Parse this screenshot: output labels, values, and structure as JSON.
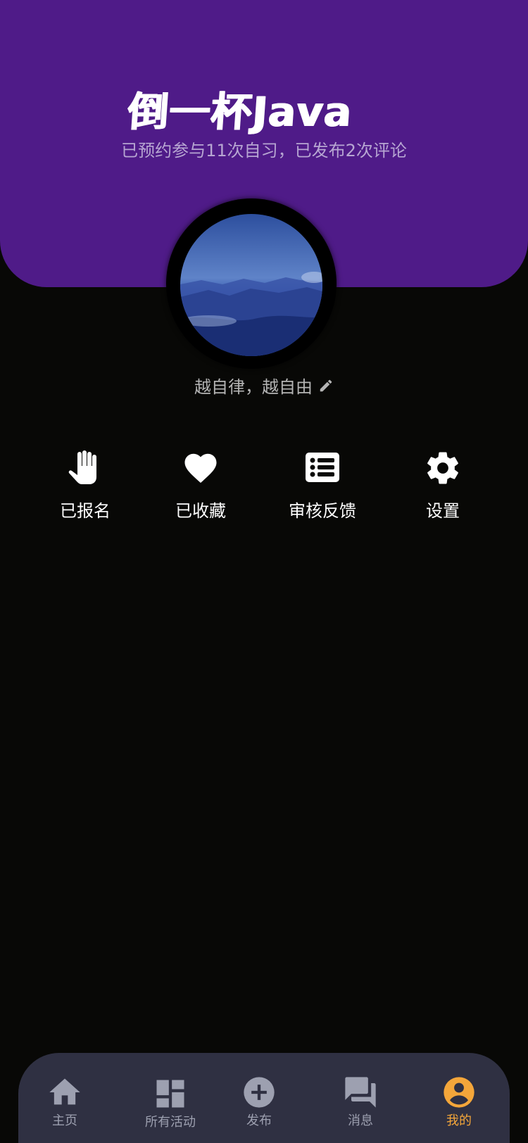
{
  "profile": {
    "username": "倒一杯Java",
    "stats": "已预约参与11次自习，已发布2次评论",
    "motto": "越自律，越自由"
  },
  "actions": [
    {
      "label": "已报名",
      "icon": "hand-icon"
    },
    {
      "label": "已收藏",
      "icon": "heart-icon"
    },
    {
      "label": "审核反馈",
      "icon": "list-icon"
    },
    {
      "label": "设置",
      "icon": "gear-icon"
    }
  ],
  "tabbar": {
    "active": "我的",
    "items": [
      {
        "label": "主页",
        "icon": "home-icon"
      },
      {
        "label": "所有活动",
        "icon": "dashboard-icon"
      },
      {
        "label": "发布",
        "icon": "add-circle-icon"
      },
      {
        "label": "消息",
        "icon": "chat-icon"
      },
      {
        "label": "我的",
        "icon": "account-circle-icon"
      }
    ]
  },
  "colors": {
    "header": "#4f1b88",
    "background": "#080806",
    "tabbar": "#2f3042",
    "active": "#f4a63a",
    "inactive": "#9da0b0"
  }
}
